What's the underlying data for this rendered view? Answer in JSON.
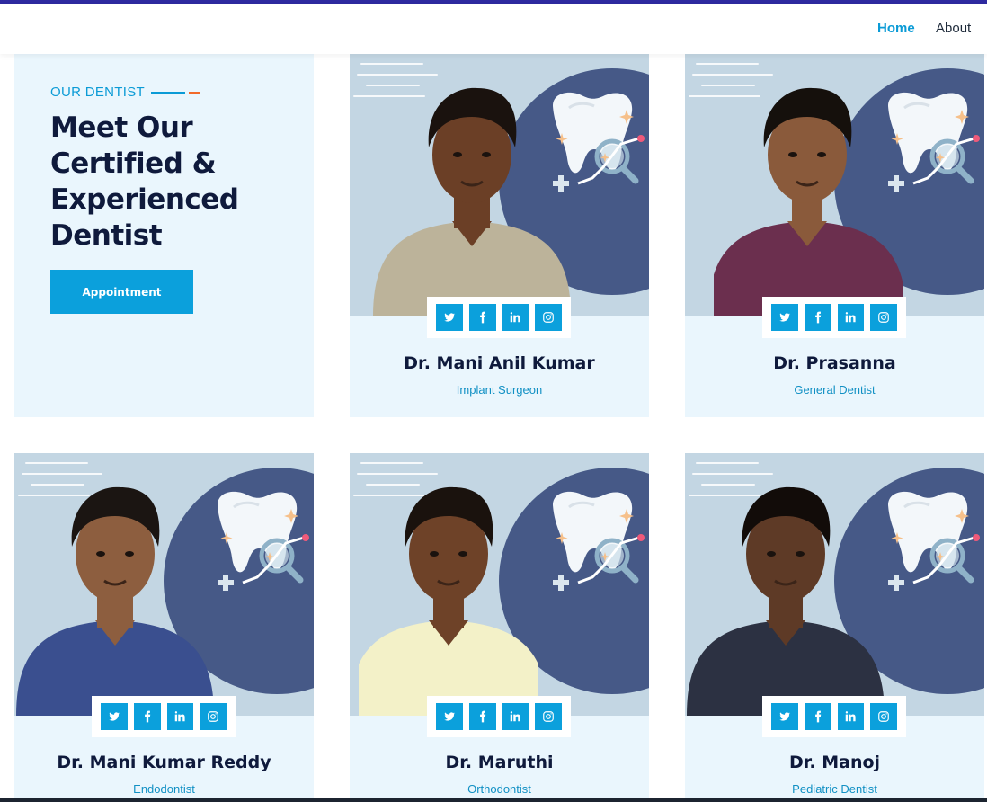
{
  "nav": {
    "home": "Home",
    "about": "About"
  },
  "intro": {
    "eyebrow": "OUR DENTIST",
    "heading": "Meet Our Certified & Experienced Dentist",
    "button": "Appointment"
  },
  "social_icons": [
    "twitter-icon",
    "facebook-icon",
    "linkedin-icon",
    "instagram-icon"
  ],
  "colors": {
    "accent": "#0ba0dc",
    "heading": "#0f1a3c",
    "card_bg": "#eaf6fd",
    "photo_bg": "#c3d6e3",
    "circle": "#465987",
    "accent_orange": "#f26a2b"
  },
  "doctors": [
    {
      "name": "Dr. Mani Anil Kumar",
      "role": "Implant Surgeon"
    },
    {
      "name": "Dr. Prasanna",
      "role": "General Dentist"
    },
    {
      "name": "Dr. Mani Kumar Reddy",
      "role": "Endodontist"
    },
    {
      "name": "Dr. Maruthi",
      "role": "Orthodontist"
    },
    {
      "name": "Dr. Manoj",
      "role": "Pediatric Dentist"
    }
  ]
}
